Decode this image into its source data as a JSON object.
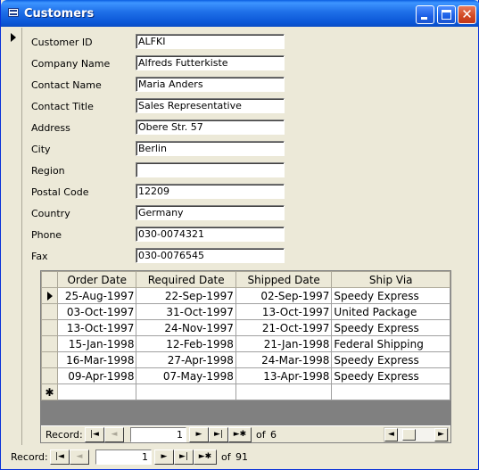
{
  "window": {
    "title": "Customers"
  },
  "form": {
    "fields": [
      {
        "label": "Customer ID",
        "value": "ALFKI"
      },
      {
        "label": "Company Name",
        "value": "Alfreds Futterkiste"
      },
      {
        "label": "Contact Name",
        "value": "Maria Anders"
      },
      {
        "label": "Contact Title",
        "value": "Sales Representative"
      },
      {
        "label": "Address",
        "value": "Obere Str. 57"
      },
      {
        "label": "City",
        "value": "Berlin"
      },
      {
        "label": "Region",
        "value": ""
      },
      {
        "label": "Postal Code",
        "value": "12209"
      },
      {
        "label": "Country",
        "value": "Germany"
      },
      {
        "label": "Phone",
        "value": "030-0074321"
      },
      {
        "label": "Fax",
        "value": "030-0076545"
      }
    ]
  },
  "orders": {
    "columns": [
      "Order Date",
      "Required Date",
      "Shipped Date",
      "Ship Via"
    ],
    "rows": [
      [
        "25-Aug-1997",
        "22-Sep-1997",
        "02-Sep-1997",
        "Speedy Express"
      ],
      [
        "03-Oct-1997",
        "31-Oct-1997",
        "13-Oct-1997",
        "United Package"
      ],
      [
        "13-Oct-1997",
        "24-Nov-1997",
        "21-Oct-1997",
        "Speedy Express"
      ],
      [
        "15-Jan-1998",
        "12-Feb-1998",
        "21-Jan-1998",
        "Federal Shipping"
      ],
      [
        "16-Mar-1998",
        "27-Apr-1998",
        "24-Mar-1998",
        "Speedy Express"
      ],
      [
        "09-Apr-1998",
        "07-May-1998",
        "13-Apr-1998",
        "Speedy Express"
      ]
    ],
    "new_row_glyph": "✱",
    "nav": {
      "label": "Record:",
      "current": "1",
      "of": "of",
      "total": "6"
    }
  },
  "main_nav": {
    "label": "Record:",
    "current": "1",
    "of": "of",
    "total": "91"
  },
  "icons": {
    "first": "|◄",
    "prev": "◄",
    "next": "►",
    "last": "►|",
    "new": "►✱",
    "scroll_left": "◄",
    "scroll_right": "►",
    "close": "✕"
  },
  "colors": {
    "titlebar": "#0a5ee0",
    "window_bg": "#ece9d8",
    "subform_bg": "#808080"
  }
}
